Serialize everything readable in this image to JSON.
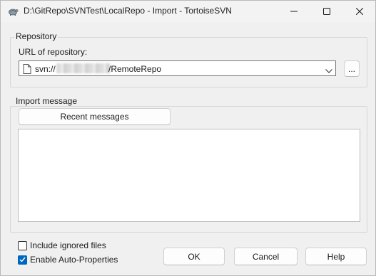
{
  "window": {
    "title": "D:\\GitRepo\\SVNTest\\LocalRepo - Import - TortoiseSVN",
    "app_icon": "tortoise-icon",
    "controls": [
      "minimize-icon",
      "maximize-icon",
      "close-icon"
    ]
  },
  "repository": {
    "group_title": "Repository",
    "url_label": "URL of repository:",
    "url_prefix": "svn://",
    "url_suffix": "/RemoteRepo",
    "browse_label": "..."
  },
  "import_message": {
    "group_title": "Import message",
    "recent_button": "Recent messages",
    "message_text": ""
  },
  "options": {
    "include_ignored": {
      "label": "Include ignored files",
      "checked": false
    },
    "auto_props": {
      "label": "Enable Auto-Properties",
      "checked": true
    }
  },
  "buttons": {
    "ok": "OK",
    "cancel": "Cancel",
    "help": "Help"
  },
  "colors": {
    "accent": "#0067c0",
    "background": "#f0f0f0"
  }
}
